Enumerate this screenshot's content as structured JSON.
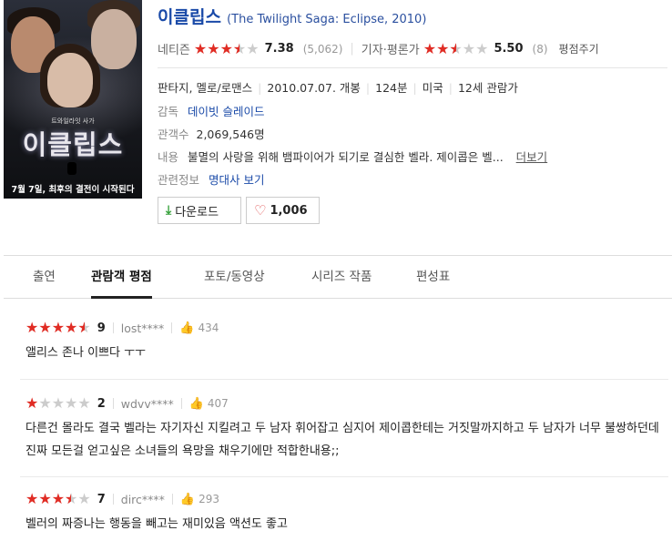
{
  "poster": {
    "title": "이클립스",
    "small_text": "트와일라잇 사가",
    "tagline": "7월 7일, 최후의 결전이 시작된다"
  },
  "movie": {
    "title": "이클립스",
    "original_title": "(The Twilight Saga: Eclipse, 2010)"
  },
  "ratings": {
    "netizen_label": "네티즌",
    "netizen_score": "7.38",
    "netizen_count": "(5,062)",
    "critic_label": "기자·평론가",
    "critic_score": "5.50",
    "critic_count": "(8)",
    "rate_link": "평점주기"
  },
  "details": {
    "genre": "판타지, 멜로/로맨스",
    "release": "2010.07.07. 개봉",
    "runtime": "124분",
    "country": "미국",
    "age": "12세 관람가",
    "director_label": "감독",
    "director": "데이빗 슬레이드",
    "audience_label": "관객수",
    "audience": "2,069,546명",
    "synopsis_label": "내용",
    "synopsis": "불멸의 사랑을 위해 뱀파이어가 되기로 결심한 벨라. 제이콥은 벨...",
    "more_label": "더보기",
    "related_label": "관련정보",
    "related_link": "명대사 보기"
  },
  "buttons": {
    "download": "다운로드",
    "like_count": "1,006"
  },
  "tabs": [
    "출연",
    "관람객 평점",
    "포토/동영상",
    "시리즈 작품",
    "편성표"
  ],
  "active_tab": "관람객 평점",
  "reviews": [
    {
      "rating": 9,
      "user": "lost****",
      "likes": "434",
      "text": "앨리스 존나 이쁘다 ㅜㅜ"
    },
    {
      "rating": 2,
      "user": "wdvv****",
      "likes": "407",
      "text": "다른건 몰라도 결국 벨라는 자기자신 지킬려고 두 남자 휘어잡고 심지어 제이콥한테는 거짓말까지하고 두 남자가 너무 불쌍하던데 진짜 모든걸 얻고싶은 소녀들의 욕망을 채우기에만 적합한내용;;"
    },
    {
      "rating": 7,
      "user": "dirc****",
      "likes": "293",
      "text": "벨러의 짜증나는 행동을 빼고는 재미있음 액션도 좋고"
    }
  ],
  "colors": {
    "star_on": "#e02c24",
    "link": "#1a4aa8",
    "download_green": "#35a03a",
    "heart": "#e05050"
  }
}
